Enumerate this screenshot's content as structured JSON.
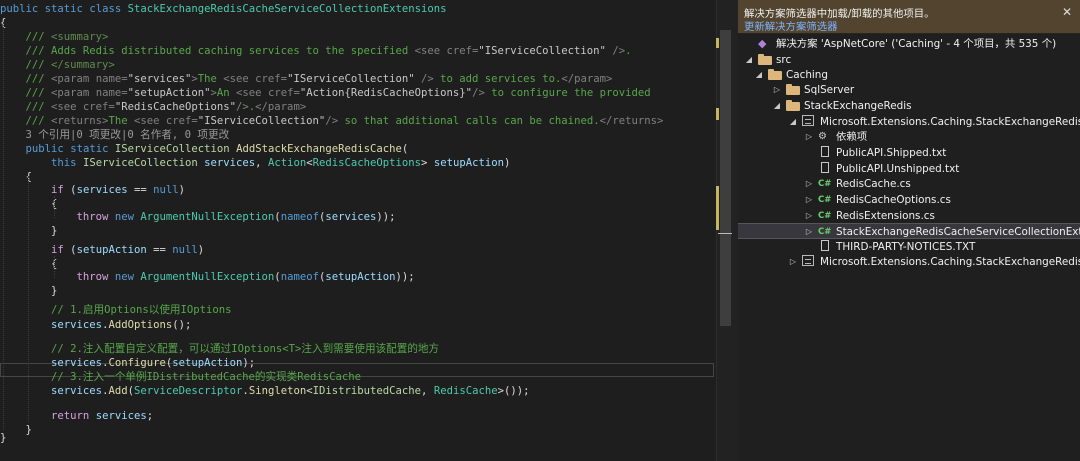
{
  "editor": {
    "lines": [
      [
        [
          "public",
          "#569cd6"
        ],
        [
          " ",
          "#dcdcdc"
        ],
        [
          "static",
          "#569cd6"
        ],
        [
          " ",
          "#dcdcdc"
        ],
        [
          "class",
          "#569cd6"
        ],
        [
          " ",
          "#dcdcdc"
        ],
        [
          "StackExchangeRedisCacheServiceCollectionExtensions",
          "#4ec9b0"
        ]
      ],
      [
        [
          "{",
          "#dcdcdc"
        ]
      ],
      [
        [
          "    /// ",
          "#57a64a"
        ],
        [
          "<summary>",
          "#608b4e"
        ]
      ],
      [
        [
          "    /// ",
          "#57a64a"
        ],
        [
          "Adds Redis distributed caching services to the specified ",
          "#57a64a"
        ],
        [
          "<see",
          "#808080"
        ],
        [
          " cref=",
          "#808080"
        ],
        [
          "\"IServiceCollection\"",
          "#c8c8c8"
        ],
        [
          " />",
          "#808080"
        ],
        [
          ".",
          "#57a64a"
        ]
      ],
      [
        [
          "    /// ",
          "#57a64a"
        ],
        [
          "</summary>",
          "#608b4e"
        ]
      ],
      [
        [
          "    /// ",
          "#57a64a"
        ],
        [
          "<param",
          "#808080"
        ],
        [
          " name=",
          "#808080"
        ],
        [
          "\"services\"",
          "#c8c8c8"
        ],
        [
          ">",
          "#808080"
        ],
        [
          "The ",
          "#57a64a"
        ],
        [
          "<see",
          "#808080"
        ],
        [
          " cref=",
          "#808080"
        ],
        [
          "\"IServiceCollection\"",
          "#c8c8c8"
        ],
        [
          " />",
          "#808080"
        ],
        [
          " to add services to.",
          "#57a64a"
        ],
        [
          "</param>",
          "#808080"
        ]
      ],
      [
        [
          "    /// ",
          "#57a64a"
        ],
        [
          "<param",
          "#808080"
        ],
        [
          " name=",
          "#808080"
        ],
        [
          "\"setupAction\"",
          "#c8c8c8"
        ],
        [
          ">",
          "#808080"
        ],
        [
          "An ",
          "#57a64a"
        ],
        [
          "<see",
          "#808080"
        ],
        [
          " cref=",
          "#808080"
        ],
        [
          "\"Action{RedisCacheOptions}\"",
          "#c8c8c8"
        ],
        [
          "/>",
          "#808080"
        ],
        [
          " to configure the provided",
          "#57a64a"
        ]
      ],
      [
        [
          "    /// ",
          "#57a64a"
        ],
        [
          "<see",
          "#808080"
        ],
        [
          " cref=",
          "#808080"
        ],
        [
          "\"RedisCacheOptions\"",
          "#c8c8c8"
        ],
        [
          "/>",
          "#808080"
        ],
        [
          ".",
          "#57a64a"
        ],
        [
          "</param>",
          "#808080"
        ]
      ],
      [
        [
          "    /// ",
          "#57a64a"
        ],
        [
          "<returns>",
          "#808080"
        ],
        [
          "The ",
          "#57a64a"
        ],
        [
          "<see",
          "#808080"
        ],
        [
          " cref=",
          "#808080"
        ],
        [
          "\"IServiceCollection\"",
          "#c8c8c8"
        ],
        [
          "/>",
          "#808080"
        ],
        [
          " so that additional calls can be chained.",
          "#57a64a"
        ],
        [
          "</returns>",
          "#808080"
        ]
      ],
      [
        [
          "    3 个引用|0 项更改|0 名作者, 0 项更改",
          "#999999"
        ]
      ],
      [
        [
          "    ",
          "#dcdcdc"
        ],
        [
          "public",
          "#569cd6"
        ],
        [
          " ",
          "#dcdcdc"
        ],
        [
          "static",
          "#569cd6"
        ],
        [
          " ",
          "#dcdcdc"
        ],
        [
          "IServiceCollection",
          "#b8d7a3"
        ],
        [
          " ",
          "#dcdcdc"
        ],
        [
          "AddStackExchangeRedisCache",
          "#dcdcaa"
        ],
        [
          "(",
          "#dcdcdc"
        ]
      ],
      [
        [
          "        ",
          "#dcdcdc"
        ],
        [
          "this",
          "#569cd6"
        ],
        [
          " ",
          "#dcdcdc"
        ],
        [
          "IServiceCollection",
          "#b8d7a3"
        ],
        [
          " ",
          "#dcdcdc"
        ],
        [
          "services",
          "#9cdcfe"
        ],
        [
          ", ",
          "#dcdcdc"
        ],
        [
          "Action",
          "#4ec9b0"
        ],
        [
          "<",
          "#dcdcdc"
        ],
        [
          "RedisCacheOptions",
          "#4ec9b0"
        ],
        [
          "> ",
          "#dcdcdc"
        ],
        [
          "setupAction",
          "#9cdcfe"
        ],
        [
          ")",
          "#dcdcdc"
        ]
      ],
      [
        [
          "    {",
          "#dcdcdc"
        ]
      ],
      [
        [
          "        ",
          "#dcdcdc"
        ],
        [
          "if",
          "#d8a0df"
        ],
        [
          " (",
          "#dcdcdc"
        ],
        [
          "services",
          "#9cdcfe"
        ],
        [
          " == ",
          "#dcdcdc"
        ],
        [
          "null",
          "#569cd6"
        ],
        [
          ")",
          "#dcdcdc"
        ]
      ],
      [
        [
          "        {",
          "#dcdcdc"
        ]
      ],
      [
        [
          "            ",
          "#dcdcdc"
        ],
        [
          "throw",
          "#d8a0df"
        ],
        [
          " ",
          "#dcdcdc"
        ],
        [
          "new",
          "#569cd6"
        ],
        [
          " ",
          "#dcdcdc"
        ],
        [
          "ArgumentNullException",
          "#4ec9b0"
        ],
        [
          "(",
          "#dcdcdc"
        ],
        [
          "nameof",
          "#569cd6"
        ],
        [
          "(",
          "#dcdcdc"
        ],
        [
          "services",
          "#9cdcfe"
        ],
        [
          "));",
          "#dcdcdc"
        ]
      ],
      [
        [
          "        }",
          "#dcdcdc"
        ]
      ],
      [
        [
          "",
          "#dcdcdc"
        ]
      ],
      [
        [
          "        ",
          "#dcdcdc"
        ],
        [
          "if",
          "#d8a0df"
        ],
        [
          " (",
          "#dcdcdc"
        ],
        [
          "setupAction",
          "#9cdcfe"
        ],
        [
          " == ",
          "#dcdcdc"
        ],
        [
          "null",
          "#569cd6"
        ],
        [
          ")",
          "#dcdcdc"
        ]
      ],
      [
        [
          "        {",
          "#dcdcdc"
        ]
      ],
      [
        [
          "            ",
          "#dcdcdc"
        ],
        [
          "throw",
          "#d8a0df"
        ],
        [
          " ",
          "#dcdcdc"
        ],
        [
          "new",
          "#569cd6"
        ],
        [
          " ",
          "#dcdcdc"
        ],
        [
          "ArgumentNullException",
          "#4ec9b0"
        ],
        [
          "(",
          "#dcdcdc"
        ],
        [
          "nameof",
          "#569cd6"
        ],
        [
          "(",
          "#dcdcdc"
        ],
        [
          "setupAction",
          "#9cdcfe"
        ],
        [
          "));",
          "#dcdcdc"
        ]
      ],
      [
        [
          "        }",
          "#dcdcdc"
        ]
      ],
      [
        [
          "",
          "#dcdcdc"
        ]
      ],
      [
        [
          "        // 1.启用Options以使用IOptions",
          "#57a64a"
        ]
      ],
      [
        [
          "        ",
          "#dcdcdc"
        ],
        [
          "services",
          "#9cdcfe"
        ],
        [
          ".",
          "#dcdcdc"
        ],
        [
          "AddOptions",
          "#dcdcaa"
        ],
        [
          "();",
          "#dcdcdc"
        ]
      ],
      [
        [
          "",
          "#dcdcdc"
        ]
      ],
      [
        [
          "        // 2.注入配置自定义配置，可以通过IOptions<T>注入到需要使用该配置的地方",
          "#57a64a"
        ]
      ],
      [
        [
          "        ",
          "#dcdcdc"
        ],
        [
          "services",
          "#9cdcfe"
        ],
        [
          ".",
          "#dcdcdc"
        ],
        [
          "Configure",
          "#dcdcaa"
        ],
        [
          "(",
          "#dcdcdc"
        ],
        [
          "setupAction",
          "#9cdcfe"
        ],
        [
          ");",
          "#dcdcdc"
        ]
      ],
      [
        [
          "        // 3.注入一个单例IDistributedCache的实现类RedisCache",
          "#57a64a"
        ]
      ],
      [
        [
          "        ",
          "#dcdcdc"
        ],
        [
          "services",
          "#9cdcfe"
        ],
        [
          ".",
          "#dcdcdc"
        ],
        [
          "Add",
          "#dcdcaa"
        ],
        [
          "(",
          "#dcdcdc"
        ],
        [
          "ServiceDescriptor",
          "#4ec9b0"
        ],
        [
          ".",
          "#dcdcdc"
        ],
        [
          "Singleton",
          "#dcdcaa"
        ],
        [
          "<",
          "#dcdcdc"
        ],
        [
          "IDistributedCache",
          "#b8d7a3"
        ],
        [
          ", ",
          "#dcdcdc"
        ],
        [
          "RedisCache",
          "#4ec9b0"
        ],
        [
          ">());",
          "#dcdcdc"
        ]
      ],
      [
        [
          "",
          "#dcdcdc"
        ]
      ],
      [
        [
          "        ",
          "#dcdcdc"
        ],
        [
          "return",
          "#d8a0df"
        ],
        [
          " ",
          "#dcdcdc"
        ],
        [
          "services",
          "#9cdcfe"
        ],
        [
          ";",
          "#dcdcdc"
        ]
      ],
      [
        [
          "    }",
          "#dcdcdc"
        ]
      ],
      [
        [
          "}",
          "#dcdcdc"
        ]
      ]
    ]
  },
  "explorer": {
    "filter_message": "解决方案筛选器中加载/卸载的其他项目。",
    "filter_link": "更新解决方案筛选器",
    "close_glyph": "✕",
    "items": [
      {
        "label": "解决方案 'AspNetCore' ('Caching' - 4 个项目，共 535 个)",
        "icon": "solution-icon",
        "arrow": "",
        "selected": false
      },
      {
        "label": "src",
        "icon": "folder-icon",
        "arrow": "◢",
        "selected": false
      },
      {
        "label": "Caching",
        "icon": "folder-icon",
        "arrow": "◢",
        "selected": false
      },
      {
        "label": "SqlServer",
        "icon": "folder-icon",
        "arrow": "▷",
        "selected": false
      },
      {
        "label": "StackExchangeRedis",
        "icon": "folder-icon",
        "arrow": "◢",
        "selected": false
      },
      {
        "label": "Microsoft.Extensions.Caching.StackExchangeRedis",
        "icon": "project-icon",
        "arrow": "◢",
        "selected": false
      },
      {
        "label": "依赖项",
        "icon": "dependencies-icon",
        "arrow": "▷",
        "selected": false
      },
      {
        "label": "PublicAPI.Shipped.txt",
        "icon": "text-file-icon",
        "arrow": "",
        "selected": false
      },
      {
        "label": "PublicAPI.Unshipped.txt",
        "icon": "text-file-icon",
        "arrow": "",
        "selected": false
      },
      {
        "label": "RedisCache.cs",
        "icon": "csharp-file-icon",
        "arrow": "▷",
        "selected": false
      },
      {
        "label": "RedisCacheOptions.cs",
        "icon": "csharp-file-icon",
        "arrow": "▷",
        "selected": false
      },
      {
        "label": "RedisExtensions.cs",
        "icon": "csharp-file-icon",
        "arrow": "▷",
        "selected": false
      },
      {
        "label": "StackExchangeRedisCacheServiceCollectionExtensions.cs",
        "icon": "csharp-file-icon",
        "arrow": "▷",
        "selected": true
      },
      {
        "label": "THIRD-PARTY-NOTICES.TXT",
        "icon": "text-file-icon",
        "arrow": "",
        "selected": false
      },
      {
        "label": "Microsoft.Extensions.Caching.StackExchangeRedis.Tests",
        "icon": "project-icon",
        "arrow": "▷",
        "selected": false
      }
    ]
  }
}
